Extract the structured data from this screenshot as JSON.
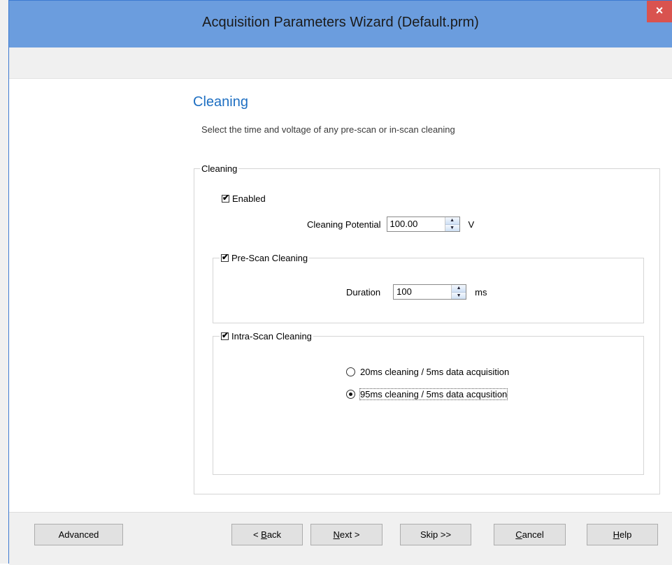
{
  "window": {
    "title": "Acquisition Parameters Wizard (Default.prm)",
    "close_glyph": "×"
  },
  "page": {
    "title": "Cleaning",
    "subtitle": "Select the time and voltage of any pre-scan or in-scan cleaning"
  },
  "cleaning_group": {
    "label": "Cleaning",
    "enabled": {
      "label": "Enabled",
      "checked": true
    },
    "potential": {
      "label": "Cleaning Potential",
      "value": "100.00",
      "unit": "V"
    },
    "pre_scan": {
      "label": "Pre-Scan Cleaning",
      "checked": true,
      "duration": {
        "label": "Duration",
        "value": "100",
        "unit": "ms"
      }
    },
    "intra_scan": {
      "label": "Intra-Scan Cleaning",
      "checked": true,
      "options": [
        {
          "label": "20ms cleaning / 5ms data acquisition",
          "selected": false
        },
        {
          "label": "95ms cleaning / 5ms data acqusition",
          "selected": true
        }
      ]
    }
  },
  "buttons": {
    "advanced": "Advanced",
    "back_prefix": "< ",
    "back_mnemonic": "B",
    "back_rest": "ack",
    "next_mnemonic": "N",
    "next_rest": "ext >",
    "skip": "Skip >>",
    "cancel_mnemonic": "C",
    "cancel_rest": "ancel",
    "help_mnemonic": "H",
    "help_rest": "elp"
  },
  "colors": {
    "titlebar": "#6b9dde",
    "close": "#d9534f",
    "heading": "#1e6fc2"
  }
}
